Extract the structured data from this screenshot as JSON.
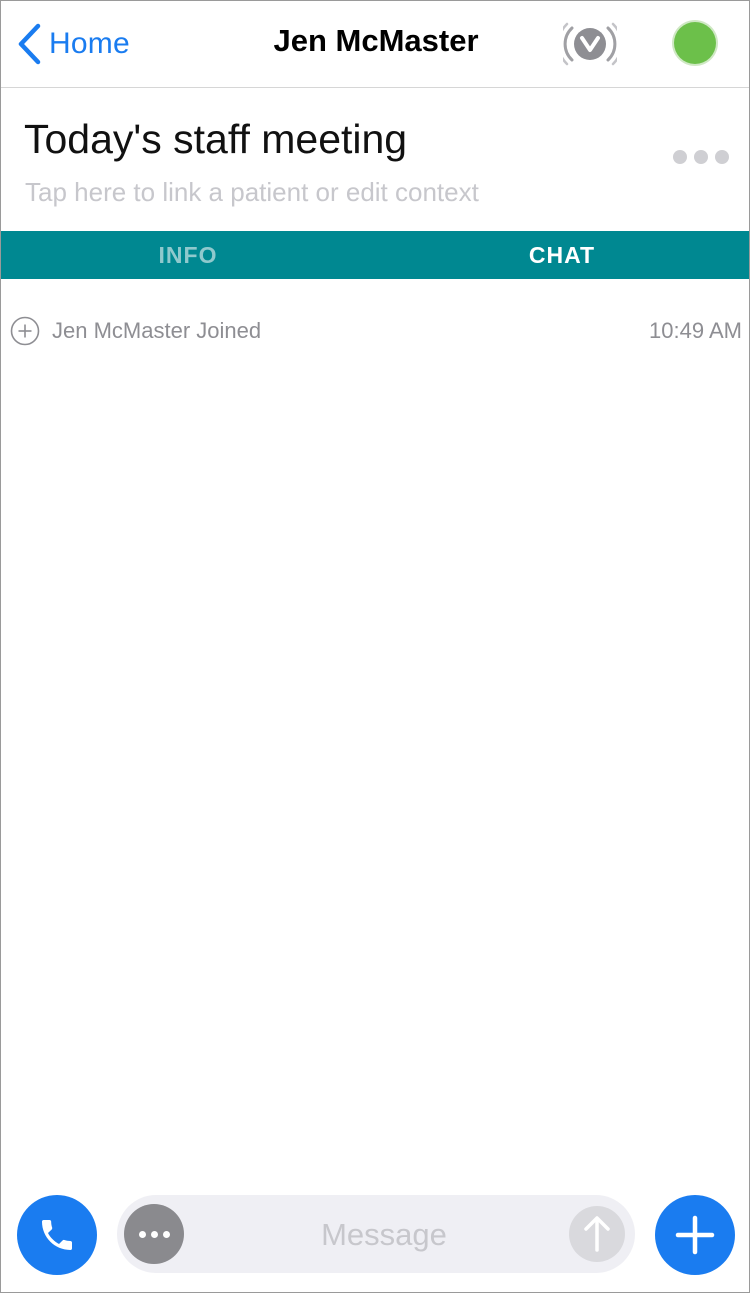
{
  "nav": {
    "back_label": "Home",
    "title": "Jen McMaster",
    "vocera_icon": "vocera-broadcast-icon",
    "status_color": "#6cc04a"
  },
  "context": {
    "title": "Today's staff meeting",
    "subtitle": "Tap here to link a patient or edit context"
  },
  "tabs": [
    {
      "label": "INFO",
      "active": false
    },
    {
      "label": "CHAT",
      "active": true
    }
  ],
  "events": [
    {
      "icon": "plus-circle-icon",
      "text": "Jen McMaster Joined",
      "time": "10:49 AM"
    }
  ],
  "composer": {
    "placeholder": "Message",
    "call_icon": "phone-icon",
    "options_icon": "ellipsis-icon",
    "send_icon": "arrow-up-icon",
    "add_icon": "plus-icon"
  },
  "colors": {
    "accent": "#1a7cf0",
    "tab_bar": "#008891",
    "status_online": "#6cc04a"
  }
}
